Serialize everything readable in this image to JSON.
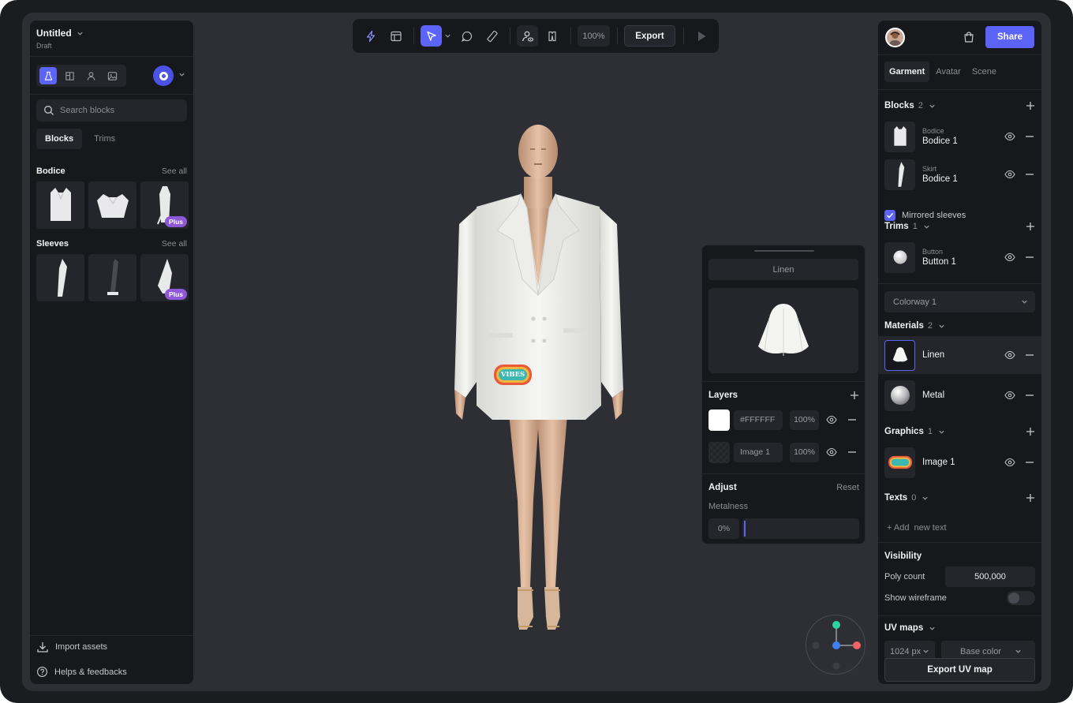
{
  "document": {
    "title": "Untitled",
    "status": "Draft"
  },
  "left_panel": {
    "category_tabs": [
      "dress-icon",
      "pattern-icon",
      "person-icon",
      "image-icon"
    ],
    "search_placeholder": "Search blocks",
    "tabs": [
      "Blocks",
      "Trims"
    ],
    "sections": [
      {
        "title": "Bodice",
        "link": "See all",
        "items": [
          {
            "name": "vest"
          },
          {
            "name": "crop"
          },
          {
            "name": "long",
            "badge": "Plus"
          }
        ]
      },
      {
        "title": "Sleeves",
        "link": "See all",
        "items": [
          {
            "name": "sleeve-1"
          },
          {
            "name": "sleeve-2"
          },
          {
            "name": "sleeve-3",
            "badge": "Plus"
          }
        ]
      }
    ],
    "footer": {
      "import": "Import assets",
      "help": "Helps & feedbacks"
    }
  },
  "toolbar": {
    "zoom": "100%",
    "export": "Export"
  },
  "viewport": {
    "patch_text": "VIBES"
  },
  "material_popup": {
    "name": "Linen",
    "layers_title": "Layers",
    "layers": [
      {
        "value": "#FFFFFF",
        "opacity": "100%"
      },
      {
        "value": "Image 1",
        "opacity": "100%"
      }
    ],
    "adjust_title": "Adjust",
    "reset": "Reset",
    "metalness_label": "Metalness",
    "metalness_value": "0%",
    "metalness_fraction": 0
  },
  "right_panel": {
    "share": "Share",
    "tabs": [
      "Garment",
      "Avatar",
      "Scene"
    ],
    "blocks": {
      "title": "Blocks",
      "count": "2",
      "items": [
        {
          "kind": "Bodice",
          "name": "Bodice 1"
        },
        {
          "kind": "Skirt",
          "name": "Bodice 1"
        }
      ]
    },
    "mirrored_sleeves": "Mirrored sleeves",
    "trims": {
      "title": "Trims",
      "count": "1",
      "items": [
        {
          "kind": "Button",
          "name": "Button 1"
        }
      ]
    },
    "colorway": "Colorway 1",
    "materials": {
      "title": "Materials",
      "count": "2",
      "items": [
        {
          "name": "Linen"
        },
        {
          "name": "Metal"
        }
      ]
    },
    "graphics": {
      "title": "Graphics",
      "count": "1",
      "items": [
        {
          "name": "Image 1"
        }
      ]
    },
    "texts": {
      "title": "Texts",
      "count": "0",
      "add": "+ Add  new text"
    },
    "visibility": {
      "title": "Visibility",
      "poly_label": "Poly count",
      "poly_value": "500,000",
      "wire_label": "Show wireframe"
    },
    "uv": {
      "title": "UV maps",
      "size": "1024 px",
      "map": "Base color",
      "export": "Export UV map"
    }
  },
  "colors": {
    "accent": "#5b64f7",
    "panel": "#17181b",
    "canvas": "#2e2f35",
    "badge": "#8e58d8"
  }
}
